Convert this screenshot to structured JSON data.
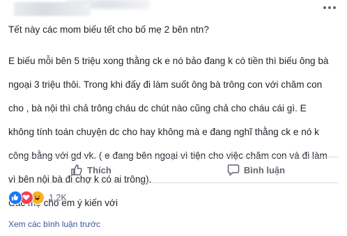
{
  "post": {
    "question": "Tết này các mom biếu tết cho bố mẹ 2 bên ntn?",
    "body_lines": [
      "E biếu mỗi bên 5 triệu xong thằng ck e nó bảo đang k có tiền thì biếu ông bà",
      "ngoại 3 triệu thôi. Trong khi đấy đi làm suốt ông bà trông con với chăm con",
      "cho , bà nội thì chả trông cháu dc chút nào cũng chả cho cháu cái gì. E",
      "không tính toán chuyện dc cho hay không mà e đang nghĩ thằng ck e nó k",
      "công bằng với gd vk. ( e đang bên ngoại vì tiện cho việc chăm con và đi làm",
      "vì bên nội bà đi chợ k có ai trông).",
      "Các mẹ cho em ý kiến với"
    ]
  },
  "actions": {
    "like_label": "Thích",
    "comment_label": "Bình luận"
  },
  "reactions": {
    "count": "1,2K",
    "types": [
      "like-icon",
      "love-icon",
      "haha-icon"
    ],
    "colors": {
      "like": "#1877f2",
      "love": "#f33e58",
      "haha": "#f7b125"
    }
  },
  "comments": {
    "view_previous": "Xem các bình luận trước"
  }
}
